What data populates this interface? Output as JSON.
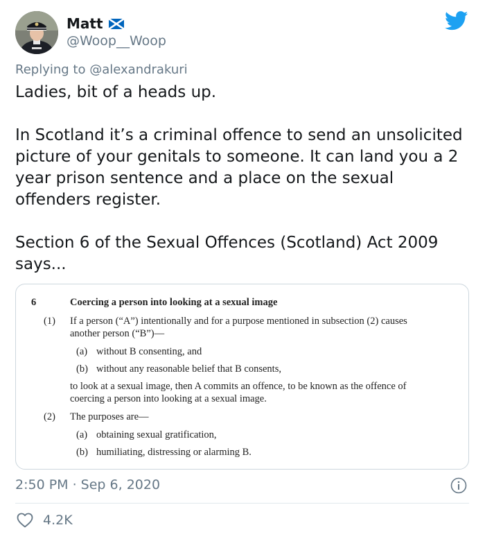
{
  "author": {
    "display_name": "Matt",
    "handle": "@Woop__Woop",
    "flag_icon": "scotland-flag-icon",
    "avatar_icon": "avatar-police-officer"
  },
  "brand": {
    "icon": "twitter-bird-icon",
    "color": "#1DA1F2"
  },
  "reply": {
    "prefix": "Replying to",
    "mention": "@alexandrakuri"
  },
  "tweet": {
    "paragraphs": [
      "Ladies, bit of a heads up.",
      "In Scotland it’s a criminal offence to send an unsolicited picture of your genitals to someone. It can land you a 2 year prison sentence and a place on the sexual offenders register.",
      "Section 6  of the Sexual Offences (Scotland) Act 2009 says..."
    ]
  },
  "document": {
    "section_number": "6",
    "section_title": "Coercing a person into looking at a sexual image",
    "sub1_num": "(1)",
    "sub1_line1": "If a person (“A”) intentionally and for a purpose mentioned in subsection (2) causes",
    "sub1_line2": "another person (“B”)—",
    "item_a_num": "(a)",
    "item_a_text": "without B consenting, and",
    "item_b_num": "(b)",
    "item_b_text": "without any reasonable belief that B consents,",
    "cont_line1": "to look at a sexual image, then A commits an offence, to be known as the offence of",
    "cont_line2": "coercing a person into looking at a sexual image.",
    "sub2_num": "(2)",
    "sub2_text": "The purposes are—",
    "purpose_a_num": "(a)",
    "purpose_a_text": "obtaining sexual gratification,",
    "purpose_b_num": "(b)",
    "purpose_b_text": "humiliating, distressing or alarming B."
  },
  "meta": {
    "timestamp": "2:50 PM · Sep 6, 2020",
    "info_icon": "info-icon"
  },
  "engagement": {
    "likes": "4.2K",
    "like_icon": "heart-icon"
  },
  "colors": {
    "text": "#14171A",
    "secondary": "#657786",
    "border": "#CCD6DD"
  }
}
